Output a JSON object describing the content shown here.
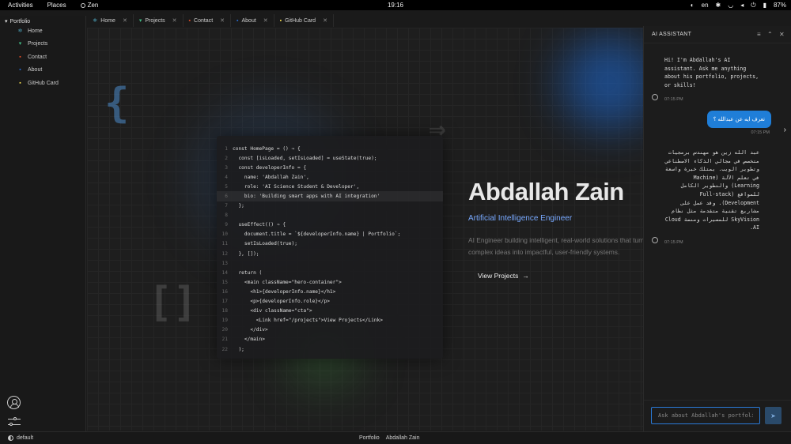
{
  "topbar": {
    "activities": "Activities",
    "places": "Places",
    "app": "Zen",
    "clock": "19:16",
    "lang": "en",
    "battery": "87%"
  },
  "sidebar": {
    "root": "Portfolio",
    "items": [
      {
        "label": "Home",
        "icon": "react-icon",
        "color": "#61dafb",
        "glyph": "⚛"
      },
      {
        "label": "Projects",
        "icon": "vue-icon",
        "color": "#41b883",
        "glyph": "▾"
      },
      {
        "label": "Contact",
        "icon": "html5-icon",
        "color": "#e44d26",
        "glyph": "▪"
      },
      {
        "label": "About",
        "icon": "css3-icon",
        "color": "#2a6fd6",
        "glyph": "▪"
      },
      {
        "label": "GitHub Card",
        "icon": "javascript-icon",
        "color": "#f0db4f",
        "glyph": "▪"
      }
    ]
  },
  "tabs": [
    {
      "label": "Home",
      "icon": "react-icon",
      "color": "#61dafb",
      "glyph": "⚛"
    },
    {
      "label": "Projects",
      "icon": "vue-icon",
      "color": "#41b883",
      "glyph": "▾"
    },
    {
      "label": "Contact",
      "icon": "html5-icon",
      "color": "#e44d26",
      "glyph": "▪"
    },
    {
      "label": "About",
      "icon": "css3-icon",
      "color": "#2a6fd6",
      "glyph": "▪"
    },
    {
      "label": "GitHub Card",
      "icon": "javascript-icon",
      "color": "#f0db4f",
      "glyph": "▪"
    }
  ],
  "code": {
    "lines": [
      {
        "n": "1",
        "t": "const HomePage = () ⇒ {"
      },
      {
        "n": "2",
        "t": "  const [isLoaded, setIsLoaded] = useState(true);"
      },
      {
        "n": "3",
        "t": "  const developerInfo = {"
      },
      {
        "n": "4",
        "t": "    name: 'Abdallah Zain',"
      },
      {
        "n": "5",
        "t": "    role: 'AI Science Student & Developer',"
      },
      {
        "n": "6",
        "t": "    bio: 'Building smart apps with AI integration'",
        "highlight": true
      },
      {
        "n": "7",
        "t": "  };"
      },
      {
        "n": "8",
        "t": ""
      },
      {
        "n": "9",
        "t": "  useEffect(() ⇒ {"
      },
      {
        "n": "10",
        "t": "    document.title = `${developerInfo.name} | Portfolio`;"
      },
      {
        "n": "11",
        "t": "    setIsLoaded(true);"
      },
      {
        "n": "12",
        "t": "  }, []);"
      },
      {
        "n": "13",
        "t": ""
      },
      {
        "n": "14",
        "t": "  return ("
      },
      {
        "n": "15",
        "t": "    <main className=\"hero-container\">"
      },
      {
        "n": "16",
        "t": "      <h1>{developerInfo.name}</h1>"
      },
      {
        "n": "17",
        "t": "      <p>{developerInfo.role}</p>"
      },
      {
        "n": "18",
        "t": "      <div className=\"cta\">"
      },
      {
        "n": "19",
        "t": "        <Link href=\"/projects\">View Projects</Link>"
      },
      {
        "n": "20",
        "t": "      </div>"
      },
      {
        "n": "21",
        "t": "    </main>"
      },
      {
        "n": "22",
        "t": "  );"
      }
    ]
  },
  "hero": {
    "name": "Abdallah Zain",
    "title": "Artificial Intelligence Engineer",
    "desc": "AI Engineer building intelligent, real-world solutions that turn complex ideas into impactful, user-friendly systems.",
    "cta": "View Projects",
    "cta_arrow": "→"
  },
  "status": {
    "profile": "default",
    "breadcrumb_1": "Portfolio",
    "breadcrumb_2": "Abdallah Zain"
  },
  "ai": {
    "title": "AI ASSISTANT",
    "greeting": "Hi! I'm Abdallah's AI assistant. Ask me anything about his portfolio, projects, or skills!",
    "greeting_time": "07:15 PM",
    "user_msg": "تعرف ايه عن عبدالله ؟",
    "user_time": "07:15 PM",
    "reply": "عبد الله زين هو مهندس برمجيات متخصص في مجالي الذكاء الاصطناعي وتطوير الويب. يمتلك خبرة واسعة في تعلم الآلة (Machine Learning) والتطوير الكامل للمواقع (Full-stack Development). وقد عمل على مشاريع تقنية متقدمة مثل نظام SkyVision للمسيرات ومنصة Cloud AI.",
    "reply_time": "07:15 PM",
    "input_placeholder": "Ask about Abdallah's portfolio..."
  }
}
